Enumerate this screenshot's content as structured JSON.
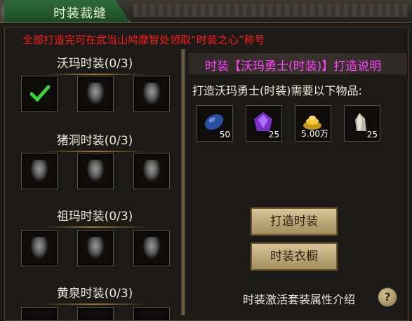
{
  "window": {
    "tab_label": "时装裁缝"
  },
  "notice": "全部打造完可在武当山鸠摩智处领取“时装之心”称号",
  "groups": [
    {
      "title": "沃玛时装(0/3)"
    },
    {
      "title": "猪洞时装(0/3)"
    },
    {
      "title": "祖玛时装(0/3)"
    },
    {
      "title": "黄泉时装(0/3)"
    }
  ],
  "detail": {
    "title": "时装【沃玛勇士(时装)】打造说明",
    "requirement": "打造沃玛勇士(时装)需要以下物品:",
    "materials": [
      {
        "icon": "blue-ore-icon",
        "count": "50"
      },
      {
        "icon": "purple-crystal-icon",
        "count": "25"
      },
      {
        "icon": "gold-pile-icon",
        "count": "5.00万"
      },
      {
        "icon": "silver-shard-icon",
        "count": "25"
      }
    ]
  },
  "buttons": {
    "craft": "打造时装",
    "wardrobe": "时装衣橱"
  },
  "footer": {
    "label": "时装激活套装属性介绍",
    "help": "?"
  },
  "colors": {
    "notice": "#ff1a1a",
    "title": "#ff40ff",
    "tab": "#2e6b3a"
  }
}
